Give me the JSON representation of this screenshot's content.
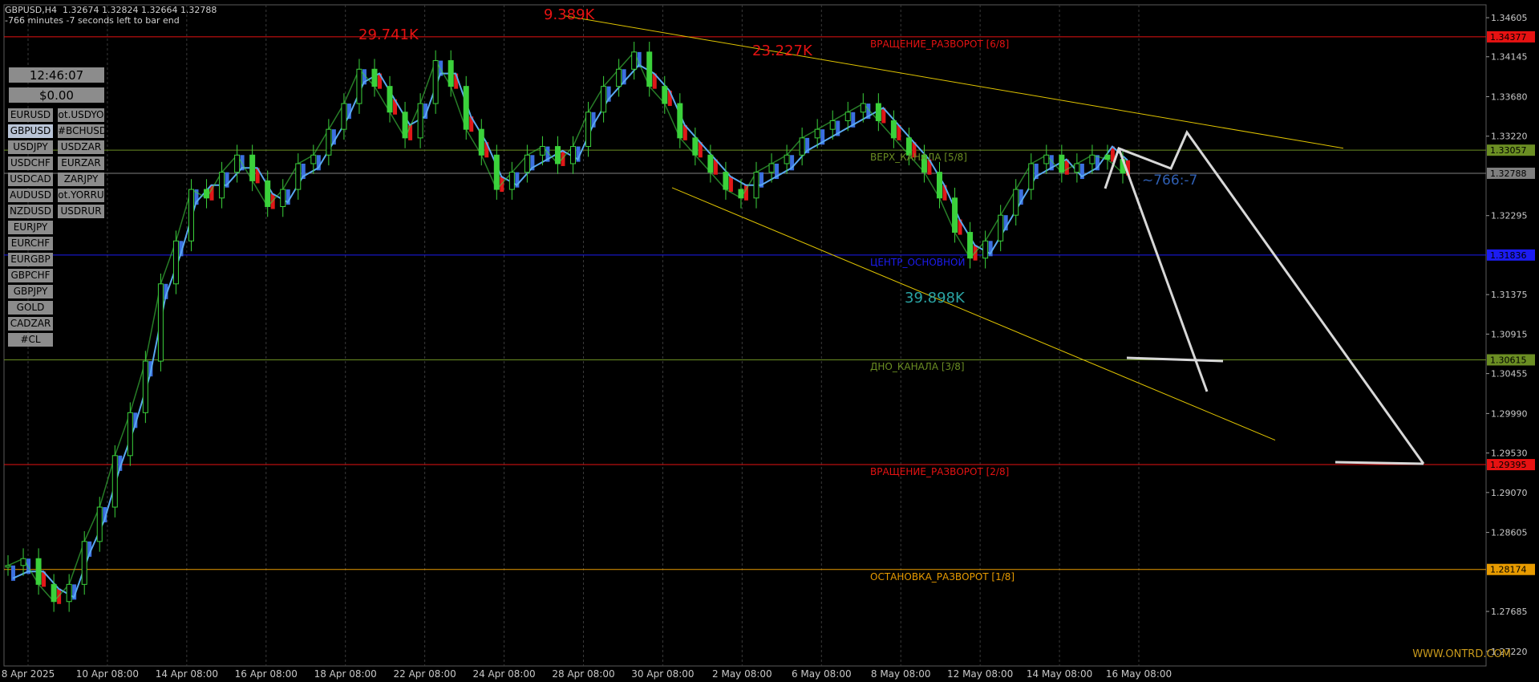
{
  "chart_data": {
    "type": "candlestick",
    "symbol": "GBPUSD,H4",
    "ohlc": "1.32674 1.32824 1.32664 1.32788",
    "countdown": "-766 minutes -7 seconds left to bar end",
    "ylim": [
      1.2705,
      1.3475
    ],
    "y_ticks": [
      1.346,
      1.34145,
      1.3368,
      1.3322,
      1.32295,
      1.31375,
      1.30915,
      1.30455,
      1.2999,
      1.2953,
      1.2907,
      1.28605,
      1.27685,
      1.2722
    ],
    "y_tick_labels": [
      "1.34605",
      "1.34145",
      "1.33680",
      "1.33220",
      "1.32295",
      "1.31375",
      "1.30915",
      "1.30455",
      "1.29990",
      "1.29530",
      "1.29070",
      "1.28605",
      "1.27685",
      "1.27220"
    ],
    "x_labels": [
      "8 Apr 2025",
      "10 Apr 08:00",
      "14 Apr 08:00",
      "16 Apr 08:00",
      "18 Apr 08:00",
      "22 Apr 08:00",
      "24 Apr 08:00",
      "28 Apr 08:00",
      "30 Apr 08:00",
      "2 May 08:00",
      "6 May 08:00",
      "8 May 08:00",
      "12 May 08:00",
      "14 May 08:00",
      "16 May 08:00"
    ],
    "close_path": [
      [
        0,
        1.2822
      ],
      [
        2,
        1.283
      ],
      [
        4,
        1.28
      ],
      [
        6,
        1.278
      ],
      [
        8,
        1.28
      ],
      [
        10,
        1.285
      ],
      [
        12,
        1.289
      ],
      [
        14,
        1.295
      ],
      [
        16,
        1.3
      ],
      [
        18,
        1.306
      ],
      [
        20,
        1.315
      ],
      [
        22,
        1.32
      ],
      [
        24,
        1.326
      ],
      [
        26,
        1.325
      ],
      [
        28,
        1.328
      ],
      [
        30,
        1.33
      ],
      [
        32,
        1.327
      ],
      [
        34,
        1.324
      ],
      [
        36,
        1.326
      ],
      [
        38,
        1.329
      ],
      [
        40,
        1.33
      ],
      [
        42,
        1.333
      ],
      [
        44,
        1.336
      ],
      [
        46,
        1.34
      ],
      [
        48,
        1.338
      ],
      [
        50,
        1.335
      ],
      [
        52,
        1.332
      ],
      [
        54,
        1.336
      ],
      [
        56,
        1.341
      ],
      [
        58,
        1.338
      ],
      [
        60,
        1.333
      ],
      [
        62,
        1.33
      ],
      [
        64,
        1.326
      ],
      [
        66,
        1.328
      ],
      [
        68,
        1.33
      ],
      [
        70,
        1.331
      ],
      [
        72,
        1.329
      ],
      [
        74,
        1.331
      ],
      [
        76,
        1.335
      ],
      [
        78,
        1.338
      ],
      [
        80,
        1.34
      ],
      [
        82,
        1.342
      ],
      [
        84,
        1.338
      ],
      [
        86,
        1.336
      ],
      [
        88,
        1.332
      ],
      [
        90,
        1.33
      ],
      [
        92,
        1.328
      ],
      [
        94,
        1.326
      ],
      [
        96,
        1.325
      ],
      [
        98,
        1.328
      ],
      [
        100,
        1.329
      ],
      [
        102,
        1.33
      ],
      [
        104,
        1.332
      ],
      [
        106,
        1.333
      ],
      [
        108,
        1.334
      ],
      [
        110,
        1.335
      ],
      [
        112,
        1.336
      ],
      [
        114,
        1.334
      ],
      [
        116,
        1.332
      ],
      [
        118,
        1.33
      ],
      [
        120,
        1.328
      ],
      [
        122,
        1.325
      ],
      [
        124,
        1.321
      ],
      [
        126,
        1.318
      ],
      [
        128,
        1.32
      ],
      [
        130,
        1.323
      ],
      [
        132,
        1.326
      ],
      [
        134,
        1.329
      ],
      [
        136,
        1.33
      ],
      [
        138,
        1.328
      ],
      [
        140,
        1.329
      ],
      [
        142,
        1.33
      ],
      [
        144,
        1.3295
      ],
      [
        146,
        1.3279
      ]
    ],
    "levels": [
      {
        "label": "ВРАЩЕНИЕ_РАЗВОРОТ [6/8]",
        "price": 1.34377,
        "tag": "1.34377",
        "color": "#e61212"
      },
      {
        "label": "ВЕРХ_КАНАЛА [5/8]",
        "price": 1.33057,
        "tag": "1.33057",
        "color": "#6b8e23"
      },
      {
        "label": "",
        "price": 1.32788,
        "tag": "1.32788",
        "color": "#7f7f7f"
      },
      {
        "label": "ЦЕНТР_ОСНОВНОЙ",
        "price": 1.31836,
        "tag": "1.31836",
        "color": "#1c1cf2"
      },
      {
        "label": "ДНО_КАНАЛА [3/8]",
        "price": 1.30615,
        "tag": "1.30615",
        "color": "#6b8e23"
      },
      {
        "label": "ВРАЩЕНИЕ_РАЗВОРОТ [2/8]",
        "price": 1.29395,
        "tag": "1.29395",
        "color": "#e61212"
      },
      {
        "label": "ОСТАНОВКА_РАЗВОРОТ [1/8]",
        "price": 1.28174,
        "tag": "1.28174",
        "color": "#e89b00"
      }
    ],
    "volume_annotations": [
      {
        "text": "29.741K",
        "price": 1.3437
      },
      {
        "text": "9.389K",
        "price": 1.346
      },
      {
        "text": "23.227K",
        "price": 1.3418
      },
      {
        "text": "39.898K",
        "price": 1.313
      }
    ],
    "timer_label": "~766:-7",
    "watermark": "WWW.ONTRD.COM"
  },
  "panel": {
    "clock": "12:46:07",
    "balance": "$0.00",
    "symbols_left": [
      "EURUSD",
      "GBPUSD",
      "USDJPY",
      "USDCHF",
      "USDCAD",
      "AUDUSD",
      "NZDUSD",
      "EURJPY",
      "EURCHF",
      "EURGBP",
      "GBPCHF",
      "GBPJPY",
      "GOLD",
      "CADZAR",
      "#CL"
    ],
    "symbols_right": [
      "ot.USDYO",
      "#BCHUSD",
      "USDZAR",
      "EURZAR",
      "ZARJPY",
      "ot.YORRU",
      "USDRUR"
    ],
    "selected": "GBPUSD"
  }
}
